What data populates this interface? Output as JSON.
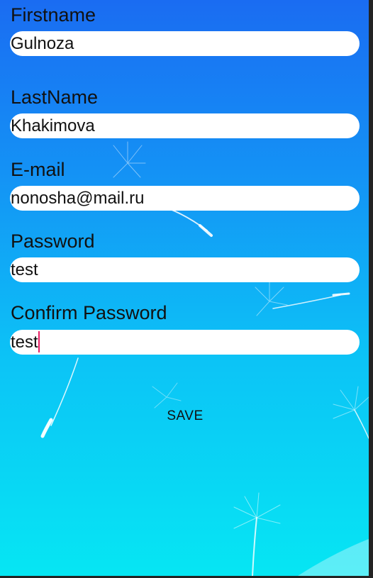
{
  "form": {
    "firstname": {
      "label": "Firstname",
      "value": "Gulnoza"
    },
    "lastname": {
      "label": "LastName",
      "value": "Khakimova"
    },
    "email": {
      "label": "E-mail",
      "value": "nonosha@mail.ru"
    },
    "password": {
      "label": "Password",
      "value": "test"
    },
    "confirm_password": {
      "label": "Confirm Password",
      "value": "test"
    },
    "save_label": "SAVE"
  },
  "colors": {
    "background_top": "#1a6cf2",
    "background_bottom": "#06e6f3",
    "caret": "#e91e63",
    "input_fill": "#ffffff"
  }
}
